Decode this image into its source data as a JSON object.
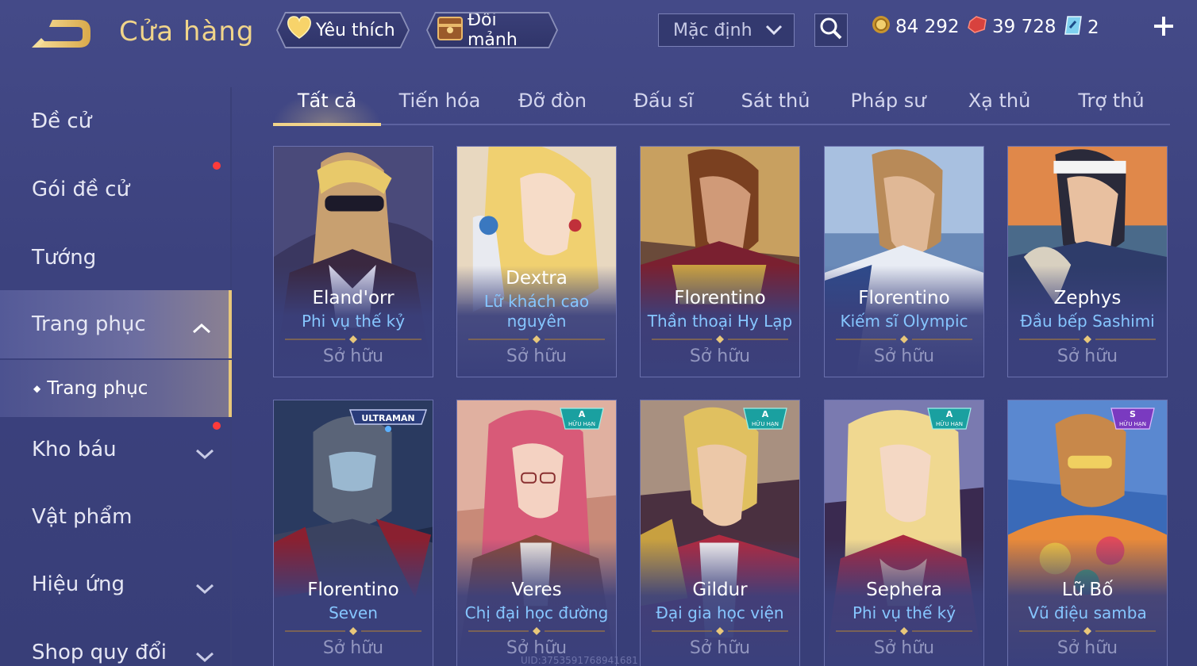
{
  "header": {
    "title": "Cửa hàng",
    "favorites_label": "Yêu thích",
    "exchange_label": "Đổi mảnh",
    "sort_value": "Mặc định",
    "gold": "84 292",
    "gems": "39 728",
    "vouchers": "2"
  },
  "sidebar": {
    "items": [
      {
        "label": "Đề cử"
      },
      {
        "label": "Gói đề cử"
      },
      {
        "label": "Tướng"
      },
      {
        "label": "Trang phục"
      },
      {
        "label": "Kho báu"
      },
      {
        "label": "Vật phẩm"
      },
      {
        "label": "Hiệu ứng"
      },
      {
        "label": "Shop quy đổi"
      }
    ],
    "sub_item": "Trang phục"
  },
  "tabs": [
    "Tất cả",
    "Tiến hóa",
    "Đỡ đòn",
    "Đấu sĩ",
    "Sát thủ",
    "Pháp sư",
    "Xạ thủ",
    "Trợ thủ"
  ],
  "cards": [
    {
      "hero": "Eland'orr",
      "skin": "Phi vụ thế kỷ",
      "status": "Sở hữu"
    },
    {
      "hero": "Dextra",
      "skin": "Lữ khách cao nguyên",
      "status": "Sở hữu"
    },
    {
      "hero": "Florentino",
      "skin": "Thần thoại Hy Lạp",
      "status": "Sở hữu"
    },
    {
      "hero": "Florentino",
      "skin": "Kiếm sĩ Olympic",
      "status": "Sở hữu"
    },
    {
      "hero": "Zephys",
      "skin": "Đầu bếp Sashimi",
      "status": "Sở hữu"
    },
    {
      "hero": "Florentino",
      "skin": "Seven",
      "status": "Sở hữu",
      "badge": "ULTRAMAN"
    },
    {
      "hero": "Veres",
      "skin": "Chị đại học đường",
      "status": "Sở hữu",
      "badge_tier": "A",
      "badge_text": "HỮU HẠN"
    },
    {
      "hero": "Gildur",
      "skin": "Đại gia học viện",
      "status": "Sở hữu",
      "badge_tier": "A",
      "badge_text": "HỮU HẠN"
    },
    {
      "hero": "Sephera",
      "skin": "Phi vụ thế kỷ",
      "status": "Sở hữu",
      "badge_tier": "A",
      "badge_text": "HỮU HẠN"
    },
    {
      "hero": "Lữ Bố",
      "skin": "Vũ điệu samba",
      "status": "Sở hữu",
      "badge_tier": "S",
      "badge_text": "HỮU HẠN"
    }
  ],
  "footer": {
    "uid": "UID:3753591768941681"
  },
  "colors": {
    "accent": "#f2d48a",
    "skin_name": "#86c6ff",
    "background": "#3e447f"
  }
}
